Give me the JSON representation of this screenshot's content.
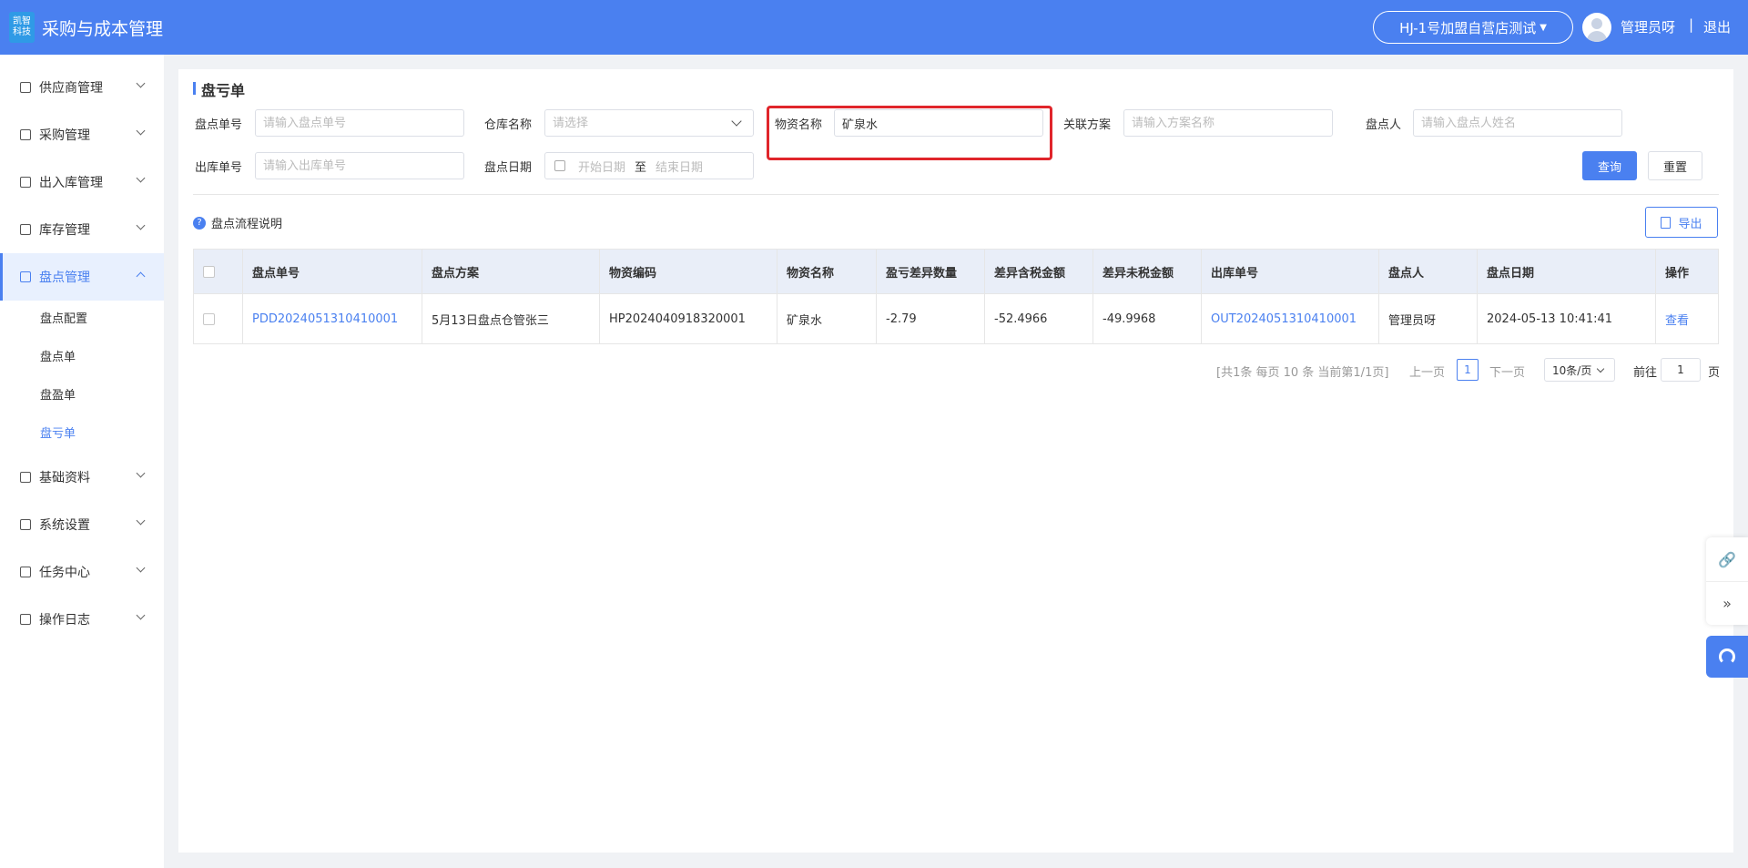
{
  "header": {
    "logo_line1": "凯智",
    "logo_line2": "科技",
    "title": "采购与成本管理",
    "store": "HJ-1号加盟自营店测试",
    "user": "管理员呀",
    "separator": "|",
    "logout": "退出"
  },
  "sidebar": {
    "supplier": "供应商管理",
    "purchase": "采购管理",
    "inout": "出入库管理",
    "stock": "库存管理",
    "inventory": "盘点管理",
    "sub": [
      "盘点配置",
      "盘点单",
      "盘盈单",
      "盘亏单"
    ],
    "basic": "基础资料",
    "system": "系统设置",
    "task": "任务中心",
    "log": "操作日志"
  },
  "page": {
    "title": "盘亏单",
    "help": "盘点流程说明",
    "help_icon": "?"
  },
  "filters": {
    "order_no_label": "盘点单号",
    "order_no_placeholder": "请输入盘点单号",
    "warehouse_label": "仓库名称",
    "warehouse_placeholder": "请选择",
    "material_label": "物资名称",
    "material_value": "矿泉水",
    "plan_label": "关联方案",
    "plan_placeholder": "请输入方案名称",
    "person_label": "盘点人",
    "person_placeholder": "请输入盘点人姓名",
    "out_no_label": "出库单号",
    "out_no_placeholder": "请输入出库单号",
    "date_label": "盘点日期",
    "start_date": "开始日期",
    "date_sep": "至",
    "end_date": "结束日期"
  },
  "buttons": {
    "query": "查询",
    "reset": "重置",
    "export": "导出"
  },
  "table": {
    "headers": [
      "盘点单号",
      "盘点方案",
      "物资编码",
      "物资名称",
      "盈亏差异数量",
      "差异含税金额",
      "差异未税金额",
      "出库单号",
      "盘点人",
      "盘点日期",
      "操作"
    ],
    "rows": [
      [
        "PDD2024051310410001",
        "5月13日盘点仓管张三",
        "HP2024040918320001",
        "矿泉水",
        "-2.79",
        "-52.4966",
        "-49.9968",
        "OUT2024051310410001",
        "管理员呀",
        "2024-05-13 10:41:41",
        "查看"
      ]
    ]
  },
  "pagination": {
    "summary": "[共1条 每页 10 条 当前第1/1页]",
    "prev": "上一页",
    "current": "1",
    "next": "下一页",
    "page_size": "10条/页",
    "goto_label": "前往",
    "goto_value": "1",
    "goto_suffix": "页"
  },
  "float_tools": {
    "link_icon": "🔗",
    "collapse_icon": "»"
  },
  "colors": {
    "primary": "#4a80f0",
    "highlight": "#e0252b"
  }
}
